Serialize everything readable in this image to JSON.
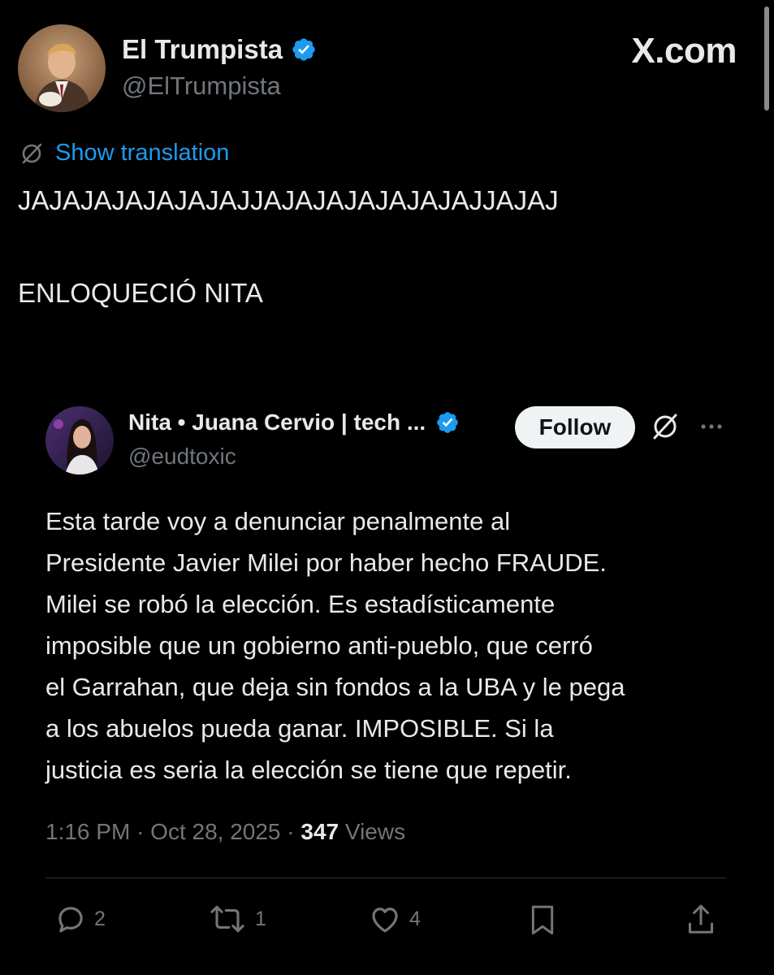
{
  "header": {
    "display_name": "El Trumpista",
    "handle": "@ElTrumpista",
    "site_brand": "X.com"
  },
  "translation": {
    "label": "Show translation"
  },
  "tweet": {
    "line1": "JAJAJAJAJAJAJAJJAJAJAJAJAJAJAJJAJAJ",
    "line2": "ENLOQUECIÓ NITA"
  },
  "quoted": {
    "display_name": "Nita • Juana Cervio | tech ...",
    "handle": "@eudtoxic",
    "follow_label": "Follow",
    "body_lines": [
      "Esta tarde voy a denunciar penalmente al",
      "Presidente Javier Milei por haber hecho FRAUDE.",
      "Milei se robó la elección. Es estadísticamente",
      "imposible que un gobierno anti-pueblo, que cerró",
      "el Garrahan, que deja sin fondos a la UBA y le pega",
      "a los abuelos pueda ganar. IMPOSIBLE. Si la",
      "justicia es seria la elección se tiene que repetir."
    ],
    "time": "1:16 PM",
    "separator": "·",
    "date": "Oct 28, 2025",
    "views_count": "347",
    "views_label": "Views",
    "actions": {
      "replies": "2",
      "reposts": "1",
      "likes": "4"
    }
  },
  "colors": {
    "background": "#000000",
    "text_primary": "#e7e9ea",
    "text_secondary": "#71767b",
    "link_blue": "#1d9bf0",
    "verified_badge": "#1d9bf0",
    "follow_button_bg": "#eff3f4"
  },
  "icons": {
    "verified": "verified-badge-icon",
    "translate": "translate-icon",
    "more": "more-options-icon",
    "reply": "reply-icon",
    "repost": "repost-icon",
    "like": "like-icon",
    "bookmark": "bookmark-icon",
    "share": "share-icon"
  }
}
